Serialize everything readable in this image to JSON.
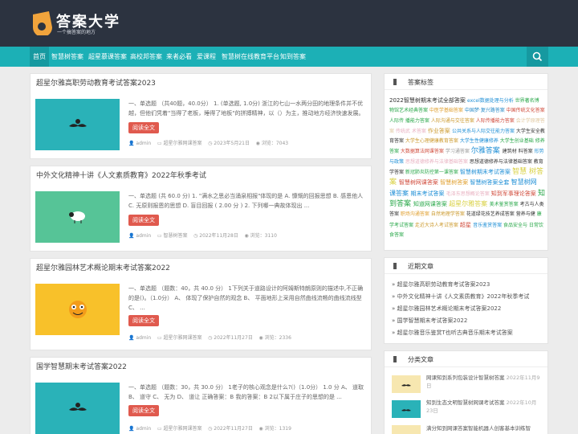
{
  "site": {
    "name": "答案大学",
    "slogan": "一个搞答案的地方"
  },
  "nav": {
    "items": [
      "首页",
      "智慧树答案",
      "超星慕课答案",
      "高校邦答案",
      "来者必看",
      "爱课程",
      "智慧树在线教育平台",
      "知到答案"
    ]
  },
  "posts": [
    {
      "title": "超星尔雅高职劳动教育考试答案2023",
      "excerpt": "一、单选题 （共40题，40.0分） 1. (单选题, 1.0分) 浙江的七山一水两分田的地理条件并不优越，但他们凭着\"当得了老板，睡得了地板\"的拼搏精神，以（）为主，推动地方经济快速发展。 A ...",
      "button": "阅读全文",
      "author": "admin",
      "category": "超星尔雅网课答案",
      "date": "2023年5月21日",
      "views": "浏览：7043",
      "thumb_color": "#2ab2b8"
    },
    {
      "title": "中外文化精神十讲《人文素质教育》2022年秋季考试",
      "excerpt": "一、单选题 (共 60.0 分) 1. \"满水之思必当涌泉相报\"体现的是 A. 慷慨的回报思想 B. 感恩他人 C. 无原则报恩的思想 D. 盲目回报 ( 2.00 分 ) 2. 下列哪一典故体现出 ...",
      "button": "阅读全文",
      "author": "admin",
      "category": "智慧树答案",
      "date": "2022年11月28日",
      "views": "浏览：3110",
      "thumb_color": "#56c497"
    },
    {
      "title": "超星尔雅园林艺术概论期末考试答案2022",
      "excerpt": "一、单选题 （题数：40，共 40.0 分） 1下列关于道路设计的阿姆斯特朗原则的描述中,不正确的是()。（1.0分） A、 体现了保护自然的观念 B、 平面地形上采用自然曲线流畅的曲线流线型 C、 ...",
      "button": "阅读全文",
      "author": "admin",
      "category": "超星尔雅网课答案",
      "date": "2022年11月27日",
      "views": "浏览：2336",
      "thumb_color": "#f8c12a"
    },
    {
      "title": "国学智慧期末考试答案2022",
      "excerpt": "一、单选题 （题数：30，共 30.0 分） 1老子的核心观念是什么?()（1.0分） 1.0 分 A、 道取 B、 道守 C、 无为 D、 道让 正确答案：B 我的答案：B 2以下属于庄子的思想的是 ...",
      "button": "阅读全文",
      "author": "admin",
      "category": "超星尔雅网课答案",
      "date": "2022年11月27日",
      "views": "浏览：1319",
      "thumb_color": "#2ab2b8"
    }
  ],
  "tags_widget": {
    "title": "答案标签",
    "tags": [
      {
        "t": "2022智慧树期末考试全部答案",
        "c": "#333",
        "s": 7
      },
      {
        "t": "excel数据处理与分析",
        "c": "#1f8fd6",
        "s": 6
      },
      {
        "t": "世界著名博",
        "c": "#2aa84a",
        "s": 6
      },
      {
        "t": "物馆艺术经典答案",
        "c": "#2aa84a",
        "s": 6
      },
      {
        "t": "中医学基础答案",
        "c": "#e0a030",
        "s": 6
      },
      {
        "t": "中国梦·复兴路答案",
        "c": "#2a8cc8",
        "s": 6
      },
      {
        "t": "中国传统文化答案",
        "c": "#d04a3a",
        "s": 6
      },
      {
        "t": "人际传",
        "c": "#2aa84a",
        "s": 6
      },
      {
        "t": "播能力答案",
        "c": "#2aa84a",
        "s": 6
      },
      {
        "t": "人际沟通与交往答案",
        "c": "#cc9a2e",
        "s": 6
      },
      {
        "t": "人际传播能力答案",
        "c": "#d04a3a",
        "s": 6
      },
      {
        "t": "会计学原理答案",
        "c": "#e0c8a0",
        "s": 6
      },
      {
        "t": "传统武",
        "c": "#e8b0c0",
        "s": 6
      },
      {
        "t": "术答案",
        "c": "#e8b0c0",
        "s": 6
      },
      {
        "t": "作业答案",
        "c": "#cc9a2e",
        "s": 7
      },
      {
        "t": "公共关系与人际交往能力答案",
        "c": "#1f8fd6",
        "s": 6
      },
      {
        "t": "大学生安全教",
        "c": "#333",
        "s": 6
      },
      {
        "t": "育答案",
        "c": "#333",
        "s": 6
      },
      {
        "t": "大学生心理健康教育答案",
        "c": "#cc9a2e",
        "s": 6
      },
      {
        "t": "大学生性健康修养",
        "c": "#1f8fd6",
        "s": 6
      },
      {
        "t": "大学生创业基础",
        "c": "#2aa84a",
        "s": 6
      },
      {
        "t": "修养答案",
        "c": "#2aa84a",
        "s": 6
      },
      {
        "t": "大数据算法网课答案",
        "c": "#d04a3a",
        "s": 6
      },
      {
        "t": "学习通答案",
        "c": "#999",
        "s": 6
      },
      {
        "t": "尔雅答案",
        "c": "#1f8fd6",
        "s": 9
      },
      {
        "t": "建筑材",
        "c": "#333",
        "s": 6
      },
      {
        "t": "料答案",
        "c": "#333",
        "s": 6
      },
      {
        "t": "形势与政策",
        "c": "#1f8fd6",
        "s": 6
      },
      {
        "t": "思想道德修养与法律基础答案",
        "c": "#e8b0c0",
        "s": 6
      },
      {
        "t": "思想道德修养与法律基础答案",
        "c": "#333",
        "s": 6
      },
      {
        "t": "教育学答案",
        "c": "#333",
        "s": 6
      },
      {
        "t": "新冠肺炎防控第一课答案",
        "c": "#2aa84a",
        "s": 6
      },
      {
        "t": "智慧树期末考试答案",
        "c": "#1f8fd6",
        "s": 7
      },
      {
        "t": "智慧",
        "c": "#d8d040",
        "s": 9
      },
      {
        "t": "树答案",
        "c": "#d8d040",
        "s": 9
      },
      {
        "t": "智慧树网课答案",
        "c": "#d04a3a",
        "s": 7
      },
      {
        "t": "智慧树答案",
        "c": "#e0a030",
        "s": 7
      },
      {
        "t": "智慧树答案全套",
        "c": "#1f8fd6",
        "s": 7
      },
      {
        "t": "智慧树网",
        "c": "#1f8fd6",
        "s": 8
      },
      {
        "t": "课答案",
        "c": "#1f8fd6",
        "s": 8
      },
      {
        "t": "期末考试答案",
        "c": "#1f8fd6",
        "s": 7
      },
      {
        "t": "毛泽东思想概论答案",
        "c": "#e8b0c0",
        "s": 6
      },
      {
        "t": "知到军事理论答案",
        "c": "#d04a3a",
        "s": 7
      },
      {
        "t": "知",
        "c": "#2aa84a",
        "s": 9
      },
      {
        "t": "到答案",
        "c": "#2aa84a",
        "s": 9
      },
      {
        "t": "知道网课答案",
        "c": "#2aa84a",
        "s": 7
      },
      {
        "t": "超星尔雅答案",
        "c": "#d8d040",
        "s": 8
      },
      {
        "t": "美术鉴赏答案",
        "c": "#2aa84a",
        "s": 6
      },
      {
        "t": "考古与人类",
        "c": "#333",
        "s": 6
      },
      {
        "t": "答案",
        "c": "#333",
        "s": 6
      },
      {
        "t": "职场沟通答案",
        "c": "#e0a030",
        "s": 6
      },
      {
        "t": "自然地理学答案",
        "c": "#cc9a2e",
        "s": 6
      },
      {
        "t": "花道绿花技艺养成答案",
        "c": "#333",
        "s": 6
      },
      {
        "t": "营养与健",
        "c": "#333",
        "s": 6
      },
      {
        "t": "康学考试答案",
        "c": "#2aa84a",
        "s": 6
      },
      {
        "t": "走近大诗人考试答案",
        "c": "#cc9a2e",
        "s": 6
      },
      {
        "t": "超星",
        "c": "#d04a3a",
        "s": 7
      },
      {
        "t": "音乐鉴赏答案",
        "c": "#1f8fd6",
        "s": 6
      },
      {
        "t": "食品安全与",
        "c": "#2aa84a",
        "s": 6
      },
      {
        "t": "日常饮食答案",
        "c": "#2aa84a",
        "s": 6
      }
    ]
  },
  "recent_widget": {
    "title": "近期文章",
    "items": [
      "超星尔雅高职劳动教育考试答案2023",
      "中外文化精神十讲《人文素质教育》2022年秋季考试",
      "超星尔雅园林艺术概论期末考试答案2022",
      "国学智慧期末考试答案2022",
      "超星尔雅音乐鉴赏T也听古典音乐期末考试答案"
    ]
  },
  "cat_widget": {
    "title": "分类文章",
    "items": [
      {
        "text": "网课知到系列包装设计智慧树答案",
        "date": "2022年11月9日",
        "color": "#f7e7b0"
      },
      {
        "text": "知到生态文明智慧树网课考试答案",
        "date": "2022年10月23日",
        "color": "#2ab2b8"
      },
      {
        "text": "满分知到网课答案智能机器人创客基本训练智",
        "date": "",
        "color": "#f7e7b0"
      }
    ]
  }
}
